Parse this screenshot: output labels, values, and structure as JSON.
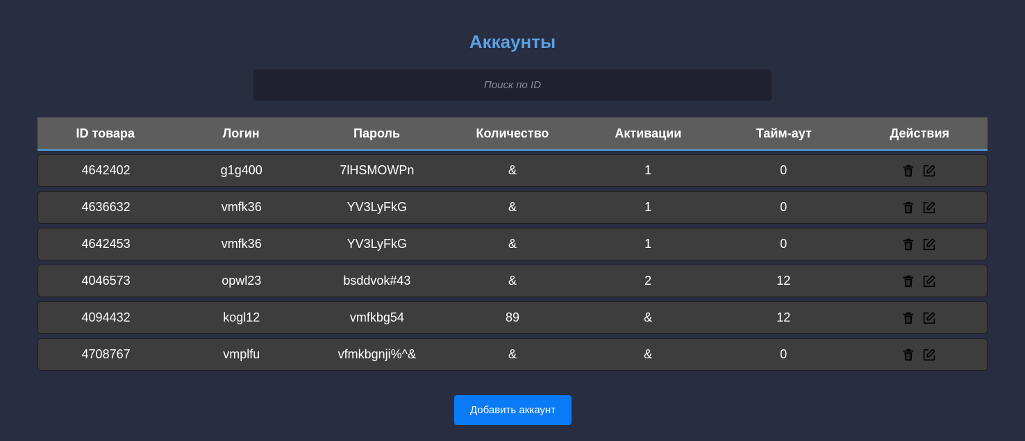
{
  "page": {
    "title": "Аккаунты"
  },
  "search": {
    "placeholder": "Поиск по ID",
    "value": ""
  },
  "table": {
    "columns": [
      "ID товара",
      "Логин",
      "Пароль",
      "Количество",
      "Активации",
      "Тайм-аут",
      "Действия"
    ],
    "rows": [
      [
        "4642402",
        "g1g400",
        "7lHSMOWPn",
        "&",
        "1",
        "0"
      ],
      [
        "4636632",
        "vmfk36",
        "YV3LyFkG",
        "&",
        "1",
        "0"
      ],
      [
        "4642453",
        "vmfk36",
        "YV3LyFkG",
        "&",
        "1",
        "0"
      ],
      [
        "4046573",
        "opwl23",
        "bsddvok#43",
        "&",
        "2",
        "12"
      ],
      [
        "4094432",
        "kogl12",
        "vmfkbg54",
        "89",
        "&",
        "12"
      ],
      [
        "4708767",
        "vmplfu",
        "vfmkbgnji%^&",
        "&",
        "&",
        "0"
      ]
    ],
    "row_icons": [
      "trash-icon",
      "edit-icon"
    ]
  },
  "add_button": {
    "label": "Добавить аккаунт"
  },
  "colors": {
    "background": "#282d42",
    "accent": "#5aa0e0",
    "button": "#0a7bf5",
    "header_bg": "#5d5d5d",
    "row_bg": "#3d3d3d"
  }
}
